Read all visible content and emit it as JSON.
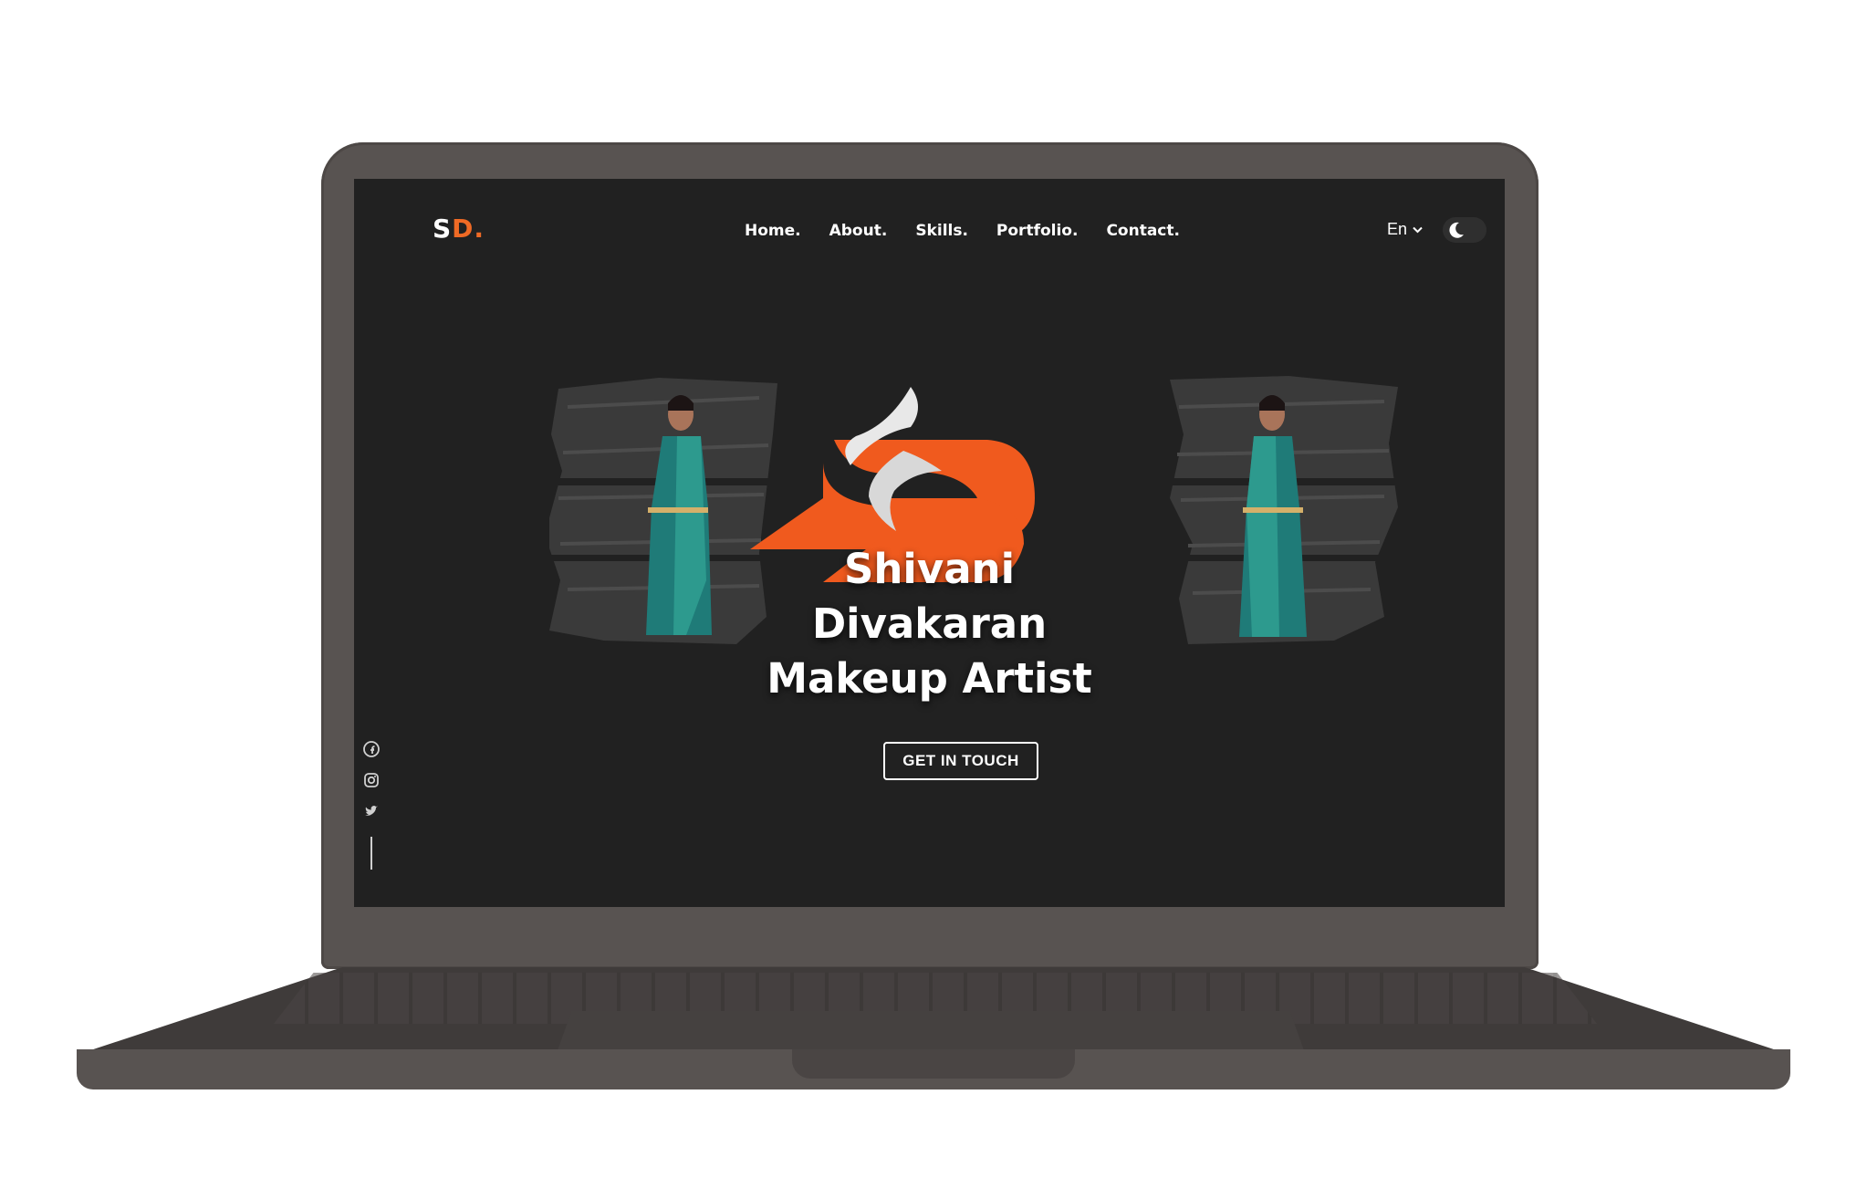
{
  "site": {
    "logo": {
      "s": "S",
      "d": "D."
    },
    "nav": [
      "Home.",
      "About.",
      "Skills.",
      "Portfolio.",
      "Contact."
    ],
    "language": "En",
    "theme_toggle": "dark",
    "hero": {
      "line1": "Shivani",
      "line2": "Divakaran",
      "line3": "Makeup Artist",
      "cta": "GET IN TOUCH"
    },
    "social": [
      "facebook-icon",
      "instagram-icon",
      "twitter-icon"
    ]
  },
  "colors": {
    "accent": "#ef6a25",
    "background": "#212121",
    "device": "#585351"
  }
}
